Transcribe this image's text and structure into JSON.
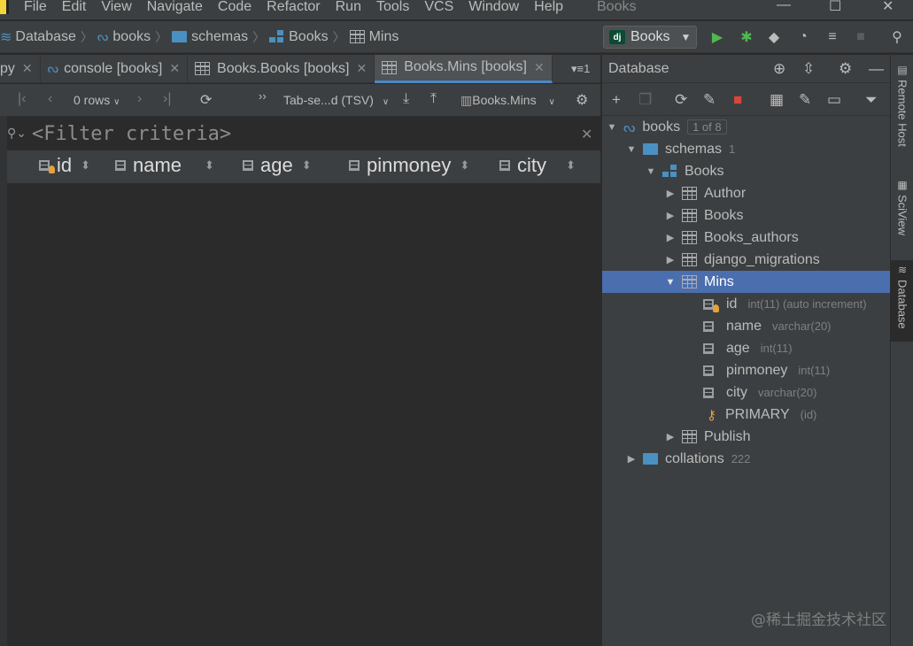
{
  "menubar": {
    "items": [
      "File",
      "Edit",
      "View",
      "Navigate",
      "Code",
      "Refactor",
      "Run",
      "Tools",
      "VCS",
      "Window",
      "Help"
    ],
    "window_title": "Books"
  },
  "breadcrumb": {
    "items": [
      "Database",
      "books",
      "schemas",
      "Books",
      "Mins"
    ]
  },
  "run_config": {
    "label": "Books"
  },
  "tabs": [
    {
      "label": "py"
    },
    {
      "label": "console [books]"
    },
    {
      "label": "Books.Books [books]"
    },
    {
      "label": "Books.Mins [books]"
    }
  ],
  "tabs_overflow": "1",
  "grid_toolbar": {
    "rows_label": "0 rows",
    "format_label": "Tab-se...d (TSV)",
    "table_label": "Books.Mins"
  },
  "filter": {
    "placeholder": "<Filter criteria>"
  },
  "grid": {
    "columns": [
      "id",
      "name",
      "age",
      "pinmoney",
      "city"
    ]
  },
  "db_panel": {
    "title": "Database",
    "tree": {
      "books": {
        "label": "books",
        "badge": "1 of 8"
      },
      "schemas": {
        "label": "schemas",
        "count": "1"
      },
      "books_schema": {
        "label": "Books"
      },
      "tables": [
        "Author",
        "Books",
        "Books_authors",
        "django_migrations"
      ],
      "mins": {
        "label": "Mins"
      },
      "columns": [
        {
          "name": "id",
          "type": "int(11) (auto increment)"
        },
        {
          "name": "name",
          "type": "varchar(20)"
        },
        {
          "name": "age",
          "type": "int(11)"
        },
        {
          "name": "pinmoney",
          "type": "int(11)"
        },
        {
          "name": "city",
          "type": "varchar(20)"
        }
      ],
      "primary": {
        "name": "PRIMARY",
        "cols": "(id)"
      },
      "publish": {
        "label": "Publish"
      },
      "collations": {
        "label": "collations",
        "count": "222"
      }
    }
  },
  "side_tabs": [
    "Remote Host",
    "SciView",
    "Database"
  ],
  "watermark": "@稀土掘金技术社区"
}
